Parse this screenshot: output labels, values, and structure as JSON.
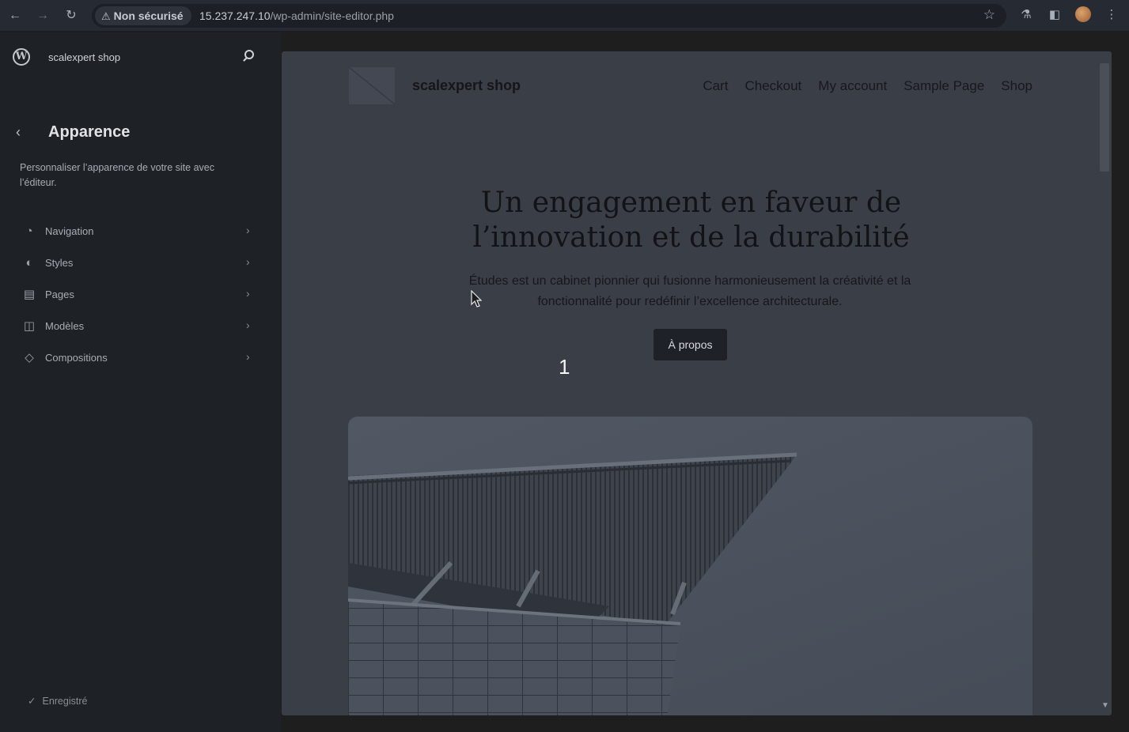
{
  "browser": {
    "security_label": "Non sécurisé",
    "url_host": "15.237.247.10",
    "url_path": "/wp-admin/site-editor.php"
  },
  "sidebar": {
    "site_name": "scalexpert shop",
    "panel_title": "Apparence",
    "panel_description": "Personnaliser l’apparence de votre site avec l’éditeur.",
    "items": [
      {
        "label": "Navigation",
        "icon": "compass-icon"
      },
      {
        "label": "Styles",
        "icon": "half-circle-icon"
      },
      {
        "label": "Pages",
        "icon": "page-icon"
      },
      {
        "label": "Modèles",
        "icon": "layout-icon"
      },
      {
        "label": "Compositions",
        "icon": "diamond-icon"
      }
    ],
    "saved_label": "Enregistré"
  },
  "preview": {
    "site_title": "scalexpert shop",
    "nav": [
      "Cart",
      "Checkout",
      "My account",
      "Sample Page",
      "Shop"
    ],
    "hero_title": "Un engagement en faveur de l’innovation et de la durabilité",
    "hero_description": "Études est un cabinet pionnier qui fusionne harmonieusement la créativité et la fonctionnalité pour redéfinir l’excellence architecturale.",
    "hero_button": "À propos"
  },
  "overlay": {
    "step_marker": "1"
  }
}
